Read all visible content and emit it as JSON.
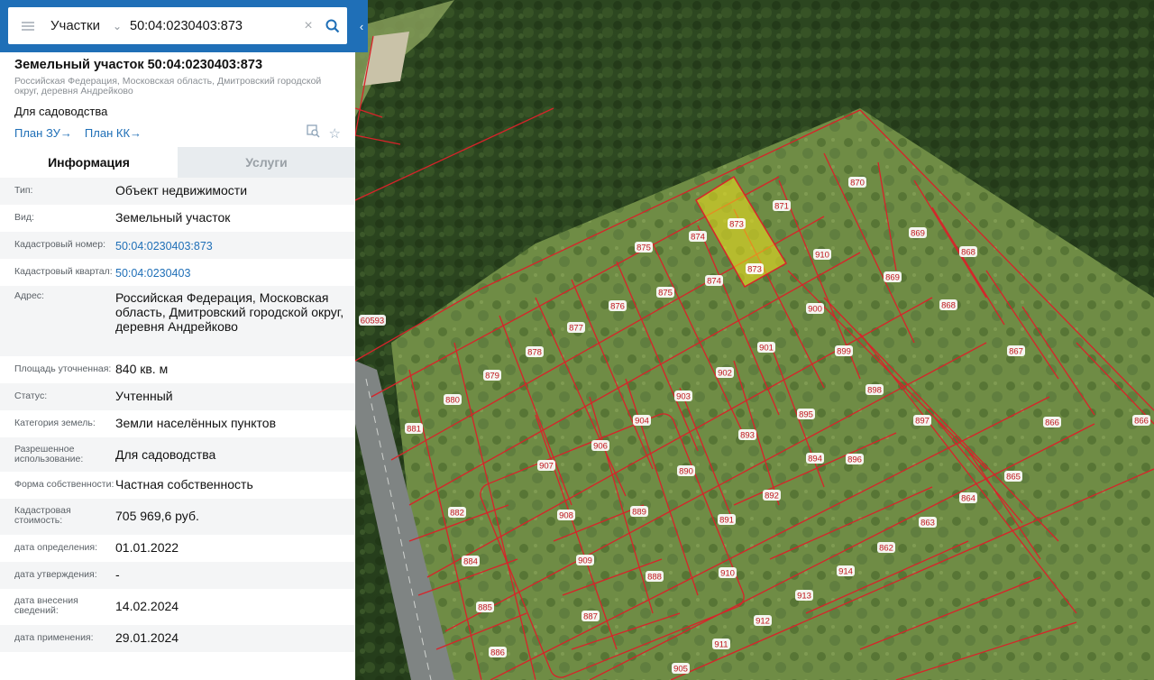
{
  "search": {
    "type_label": "Участки",
    "query": "50:04:0230403:873"
  },
  "card": {
    "title": "Земельный участок 50:04:0230403:873",
    "address_sub": "Российская Федерация, Московская область, Дмитровский городской округ, деревня Андрейково",
    "use": "Для садоводства",
    "plan_zu": "План ЗУ",
    "plan_kk": "План КК"
  },
  "tabs": [
    "Информация",
    "Услуги"
  ],
  "info": [
    {
      "label": "Тип:",
      "value": "Объект недвижимости"
    },
    {
      "label": "Вид:",
      "value": "Земельный участок"
    },
    {
      "label": "Кадастровый номер:",
      "value": "50:04:0230403:873"
    },
    {
      "label": "Кадастровый квартал:",
      "value": "50:04:0230403"
    },
    {
      "label": "Адрес:",
      "value": "Российская Федерация, Московская область, Дмитровский городской округ, деревня Андрейково"
    },
    {
      "label": "Площадь уточненная:",
      "value": "840 кв. м"
    },
    {
      "label": "Статус:",
      "value": "Учтенный"
    },
    {
      "label": "Категория земель:",
      "value": "Земли населённых пунктов"
    },
    {
      "label": "Разрешенное использование:",
      "value": "Для садоводства"
    },
    {
      "label": "Форма собственности:",
      "value": "Частная собственность"
    },
    {
      "label": "Кадастровая стоимость:",
      "value": "705 969,6 руб."
    },
    {
      "label": "дата определения:",
      "value": "01.01.2022"
    },
    {
      "label": "дата утверждения:",
      "value": "-"
    },
    {
      "label": "дата внесения сведений:",
      "value": "14.02.2024"
    },
    {
      "label": "дата применения:",
      "value": "29.01.2024"
    }
  ],
  "map": {
    "highlight_color": "#f0e21c",
    "boundary_color": "#d8232a",
    "parcel_labels": [
      "870",
      "871",
      "873",
      "873",
      "874",
      "874",
      "875",
      "875",
      "869",
      "869",
      "868",
      "868",
      "867",
      "866",
      "866",
      "865",
      "864",
      "863",
      "862",
      "910",
      "900",
      "901",
      "899",
      "898",
      "897",
      "896",
      "895",
      "894",
      "893",
      "892",
      "891",
      "890",
      "889",
      "888",
      "887",
      "886",
      "885",
      "884",
      "882",
      "881",
      "880",
      "879",
      "878",
      "877",
      "876",
      "902",
      "903",
      "904",
      "905",
      "906",
      "907",
      "908",
      "909",
      "910",
      "911",
      "912",
      "913",
      "914",
      "60593"
    ]
  }
}
